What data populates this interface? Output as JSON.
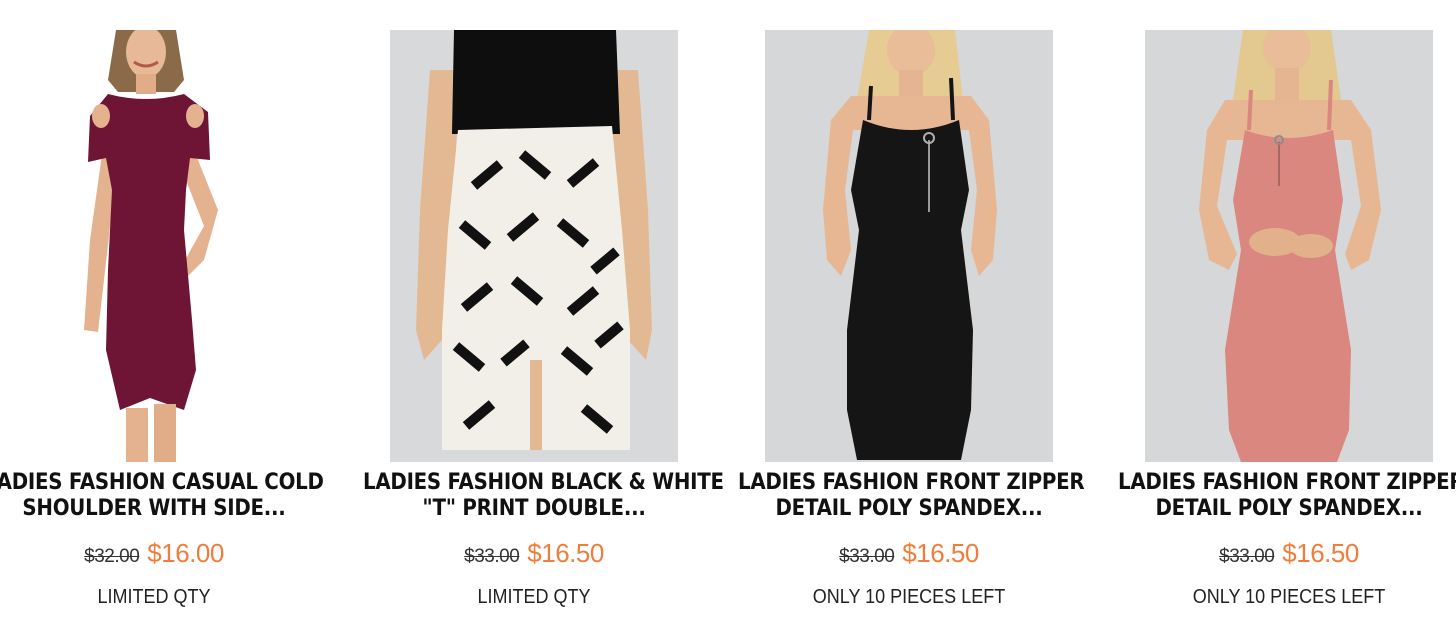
{
  "products": [
    {
      "title_line1": "LADIES FASHION CASUAL COLD",
      "title_line2": "SHOULDER WITH SIDE...",
      "old_price": "$32.00",
      "price": "$16.00",
      "stock": "LIMITED QTY",
      "image_icon": "product-photo-burgundy-dress",
      "color": "#6e1535"
    },
    {
      "title_line1": "LADIES FASHION BLACK & WHITE",
      "title_line2": "\"T\" PRINT DOUBLE...",
      "old_price": "$33.00",
      "price": "$16.50",
      "stock": "LIMITED QTY",
      "image_icon": "product-photo-print-skirt",
      "color": "#f2efe8"
    },
    {
      "title_line1": "LADIES FASHION FRONT ZIPPER",
      "title_line2": "DETAIL POLY SPANDEX...",
      "old_price": "$33.00",
      "price": "$16.50",
      "stock": "ONLY 10 PIECES LEFT",
      "image_icon": "product-photo-black-dress",
      "color": "#151515"
    },
    {
      "title_line1": "LADIES FASHION FRONT ZIPPER",
      "title_line2": "DETAIL POLY SPANDEX...",
      "old_price": "$33.00",
      "price": "$16.50",
      "stock": "ONLY 10 PIECES LEFT",
      "image_icon": "product-photo-pink-dress",
      "color": "#d9877f"
    }
  ],
  "colors": {
    "sale_price": "#f07d3c",
    "text": "#111111"
  }
}
